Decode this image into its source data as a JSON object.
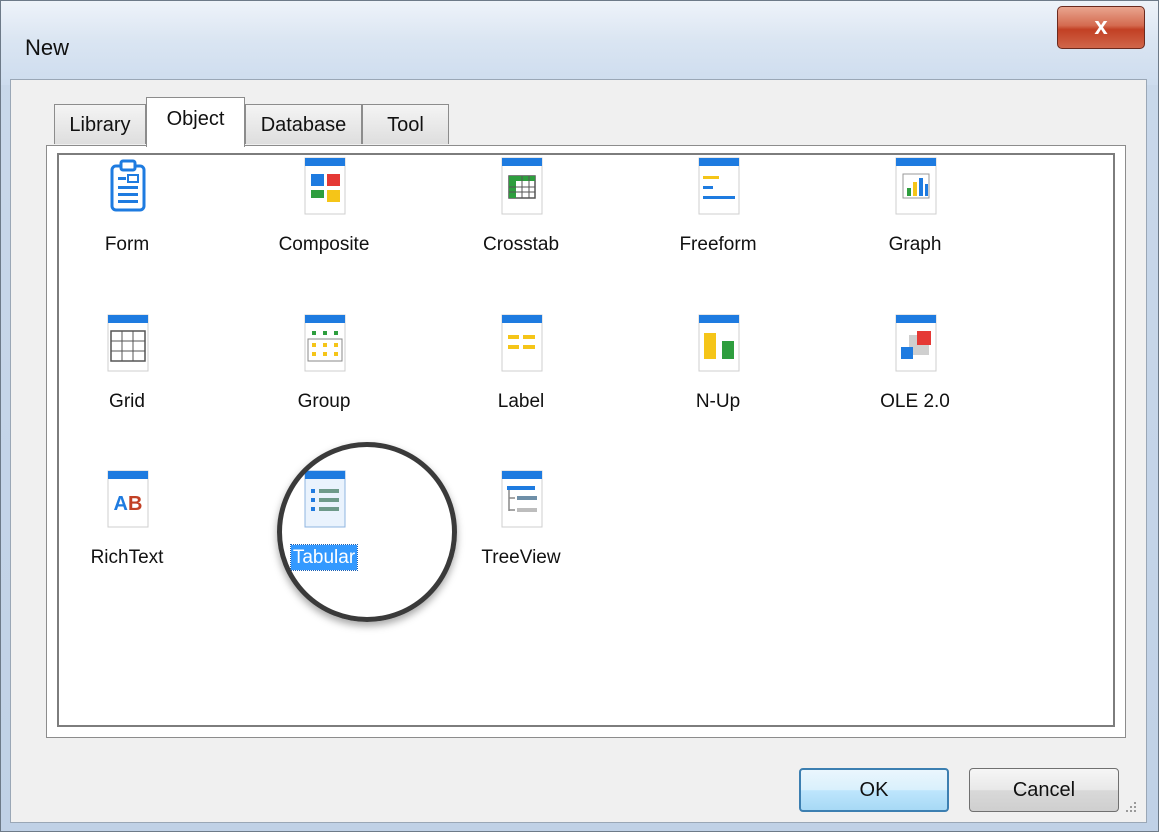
{
  "window": {
    "title": "New",
    "close_label": "x"
  },
  "tabs": [
    {
      "label": "Library",
      "active": false
    },
    {
      "label": "Object",
      "active": true
    },
    {
      "label": "Database",
      "active": false
    },
    {
      "label": "Tool",
      "active": false
    }
  ],
  "items": [
    {
      "label": "Form",
      "icon": "form-icon"
    },
    {
      "label": "Composite",
      "icon": "composite-icon"
    },
    {
      "label": "Crosstab",
      "icon": "crosstab-icon"
    },
    {
      "label": "Freeform",
      "icon": "freeform-icon"
    },
    {
      "label": "Graph",
      "icon": "graph-icon"
    },
    {
      "label": "Grid",
      "icon": "grid-icon"
    },
    {
      "label": "Group",
      "icon": "group-icon"
    },
    {
      "label": "Label",
      "icon": "label-icon"
    },
    {
      "label": "N-Up",
      "icon": "n-up-icon"
    },
    {
      "label": "OLE 2.0",
      "icon": "ole-icon"
    },
    {
      "label": "RichText",
      "icon": "richtext-icon"
    },
    {
      "label": "Tabular",
      "icon": "tabular-icon",
      "selected": true
    },
    {
      "label": "TreeView",
      "icon": "treeview-icon"
    }
  ],
  "richtext_icon_text": "AB",
  "buttons": {
    "ok": "OK",
    "cancel": "Cancel"
  },
  "colors": {
    "accent_blue": "#1e7be0",
    "selection": "#3399ff",
    "close_red": "#c24024"
  }
}
